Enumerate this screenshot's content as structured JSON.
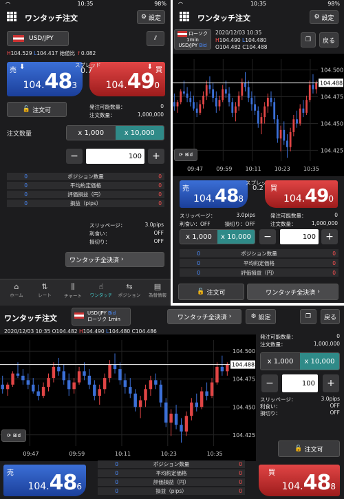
{
  "status": {
    "time": "10:35",
    "battery": "98%"
  },
  "app": {
    "title": "ワンタッチ注文",
    "settings": "設定",
    "back": "戻る",
    "lock": "注文可",
    "close_all": "ワンタッチ全決済",
    "bid": "Bid",
    "symbol": "USD/JPY"
  },
  "p1": {
    "high": "104.529",
    "low": "104.417",
    "change_label": "始値比",
    "change": "0.082",
    "spread_label": "スプレッド",
    "spread": "0.7",
    "sell": {
      "label": "売",
      "small": "104.",
      "big": "48",
      "tail": "3"
    },
    "buy": {
      "label": "買",
      "small": "104.",
      "big": "49",
      "tail": "0"
    },
    "avail_label": "発注可能数量：",
    "avail": "0",
    "order_label": "注文数量：",
    "order": "1,000,000",
    "qty_label": "注文数量",
    "qty_opt1": "x 1,000",
    "qty_opt2": "x 10,000",
    "qty": "100",
    "rows": [
      {
        "label": "ポジション数量",
        "buy": "0",
        "sell": "0"
      },
      {
        "label": "平均約定価格",
        "buy": "0",
        "sell": "0"
      },
      {
        "label": "評価損益（円）",
        "buy": "0",
        "sell": "0"
      },
      {
        "label": "損益（pips）",
        "buy": "0",
        "sell": "0"
      }
    ],
    "slip_label": "スリッページ：",
    "slip": "3.0pips",
    "tp_label": "利食い：",
    "tp": "OFF",
    "sl_label": "損切り：",
    "sl": "OFF",
    "tabs": [
      "ホーム",
      "レート",
      "チャート",
      "ワンタッチ",
      "ポジション",
      "為替情報"
    ]
  },
  "p2": {
    "candle": "ローソク",
    "tf": "1min",
    "date": "2020/12/03 10:35",
    "h": "104.490",
    "l": "104.480",
    "o": "104.482",
    "c": "104.488",
    "sell": {
      "label": "売",
      "small": "104.",
      "big": "48",
      "tail": "8"
    },
    "buy": {
      "label": "買",
      "small": "104.",
      "big": "49",
      "tail": "0"
    },
    "spread_label": "スプレッド",
    "spread": "0.2",
    "slip_label": "スリッページ：",
    "slip": "3.0pips",
    "tp_label": "利食い：OFF",
    "sl_label": "損切り：OFF",
    "avail_label": "発注可能数量：",
    "avail": "0",
    "order_label": "注文数量：",
    "order": "1,000,000",
    "qty": "100"
  },
  "p3": {
    "date": "2020/12/03 10:35",
    "o": "104.482",
    "h": "104.490",
    "l": "104.480",
    "c": "104.486",
    "candle": "ローソク 1min",
    "sell": {
      "label": "売",
      "small": "104.",
      "big": "48",
      "tail": "6"
    },
    "buy": {
      "label": "買",
      "small": "104.",
      "big": "48",
      "tail": "8"
    },
    "avail_label": "発注可能数量：",
    "avail": "0",
    "order_label": "注文数量：",
    "order": "1,000,000",
    "qty": "100",
    "slip_label": "スリッページ：",
    "slip": "3.0pips",
    "tp_label": "利食い：",
    "tp": "OFF",
    "sl_label": "損切り：",
    "sl": "OFF"
  },
  "chart_data": {
    "type": "candlestick",
    "x_ticks": [
      "09:47",
      "09:59",
      "10:11",
      "10:23",
      "10:35"
    ],
    "y_ticks": [
      "104.500",
      "104.475",
      "104.450",
      "104.425"
    ],
    "current": "104.488",
    "ylim": [
      104.415,
      104.51
    ],
    "candles": [
      [
        104.47,
        104.478,
        104.462,
        104.466
      ],
      [
        104.466,
        104.472,
        104.46,
        104.47
      ],
      [
        104.47,
        104.482,
        104.468,
        104.48
      ],
      [
        104.48,
        104.49,
        104.476,
        104.478
      ],
      [
        104.478,
        104.484,
        104.47,
        104.474
      ],
      [
        104.474,
        104.48,
        104.466,
        104.47
      ],
      [
        104.47,
        104.476,
        104.462,
        104.464
      ],
      [
        104.464,
        104.47,
        104.456,
        104.46
      ],
      [
        104.46,
        104.472,
        104.458,
        104.468
      ],
      [
        104.468,
        104.48,
        104.464,
        104.476
      ],
      [
        104.476,
        104.49,
        104.472,
        104.486
      ],
      [
        104.486,
        104.494,
        104.478,
        104.482
      ],
      [
        104.482,
        104.488,
        104.47,
        104.474
      ],
      [
        104.474,
        104.48,
        104.46,
        104.466
      ],
      [
        104.466,
        104.476,
        104.462,
        104.472
      ],
      [
        104.472,
        104.486,
        104.47,
        104.482
      ],
      [
        104.482,
        104.49,
        104.474,
        104.478
      ],
      [
        104.478,
        104.484,
        104.466,
        104.47
      ],
      [
        104.47,
        104.474,
        104.456,
        104.46
      ],
      [
        104.46,
        104.47,
        104.452,
        104.466
      ],
      [
        104.466,
        104.48,
        104.462,
        104.476
      ],
      [
        104.476,
        104.492,
        104.472,
        104.488
      ],
      [
        104.488,
        104.498,
        104.48,
        104.484
      ],
      [
        104.484,
        104.49,
        104.47,
        104.474
      ],
      [
        104.474,
        104.48,
        104.462,
        104.468
      ],
      [
        104.468,
        104.476,
        104.458,
        104.462
      ],
      [
        104.462,
        104.466,
        104.446,
        104.45
      ],
      [
        104.45,
        104.46,
        104.44,
        104.456
      ],
      [
        104.456,
        104.47,
        104.45,
        104.466
      ],
      [
        104.466,
        104.478,
        104.46,
        104.474
      ],
      [
        104.474,
        104.48,
        104.466,
        104.47
      ],
      [
        104.47,
        104.474,
        104.45,
        104.454
      ],
      [
        104.454,
        104.458,
        104.432,
        104.436
      ],
      [
        104.436,
        104.448,
        104.424,
        104.444
      ],
      [
        104.444,
        104.452,
        104.43,
        104.434
      ],
      [
        104.434,
        104.44,
        104.418,
        104.428
      ],
      [
        104.428,
        104.446,
        104.424,
        104.442
      ],
      [
        104.442,
        104.458,
        104.438,
        104.454
      ],
      [
        104.454,
        104.462,
        104.446,
        104.45
      ],
      [
        104.45,
        104.468,
        104.448,
        104.464
      ],
      [
        104.464,
        104.472,
        104.456,
        104.46
      ],
      [
        104.46,
        104.476,
        104.458,
        104.472
      ],
      [
        104.472,
        104.49,
        104.47,
        104.486
      ],
      [
        104.486,
        104.496,
        104.478,
        104.482
      ],
      [
        104.482,
        104.49,
        104.478,
        104.488
      ]
    ]
  }
}
